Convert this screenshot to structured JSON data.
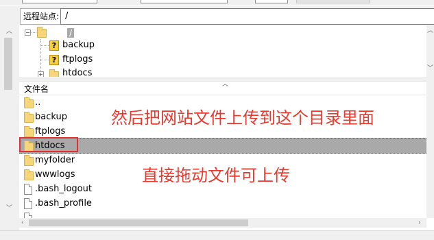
{
  "remote_site": {
    "label": "远程站点:",
    "path": "/"
  },
  "tree": {
    "root_label": "/",
    "children": [
      "backup",
      "ftplogs",
      "htdocs"
    ]
  },
  "file_list": {
    "column_header": "文件名",
    "rows": [
      {
        "name": "..",
        "type": "folder"
      },
      {
        "name": "backup",
        "type": "folder"
      },
      {
        "name": "ftplogs",
        "type": "folder"
      },
      {
        "name": "htdocs",
        "type": "folder",
        "selected": true
      },
      {
        "name": "myfolder",
        "type": "folder"
      },
      {
        "name": "wwwlogs",
        "type": "folder"
      },
      {
        "name": ".bash_logout",
        "type": "file"
      },
      {
        "name": ".bash_profile",
        "type": "file"
      }
    ]
  },
  "annotations": {
    "upload_instruction": "然后把网站文件上传到这个目录里面",
    "drag_hint": "直接拖动文件可上传"
  },
  "colors": {
    "annotation": "#e53b2f",
    "selection": "#a9a9a9",
    "folder": "#f5d67a",
    "highlight_box": "#e03030"
  }
}
